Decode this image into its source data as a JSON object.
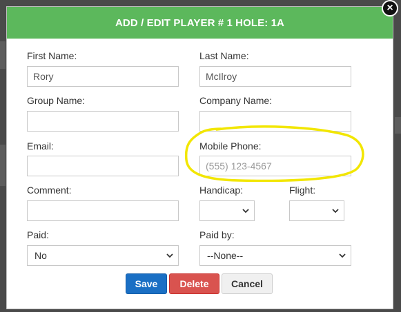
{
  "modal": {
    "title": "ADD / EDIT PLAYER # 1 HOLE: 1A",
    "close_symbol": "×",
    "header_color": "#5cb85c"
  },
  "form": {
    "first_name": {
      "label": "First Name:",
      "value": "Rory",
      "placeholder": ""
    },
    "last_name": {
      "label": "Last Name:",
      "value": "McIlroy",
      "placeholder": ""
    },
    "group_name": {
      "label": "Group Name:",
      "value": "",
      "placeholder": ""
    },
    "company_name": {
      "label": "Company Name:",
      "value": "",
      "placeholder": ""
    },
    "email": {
      "label": "Email:",
      "value": "",
      "placeholder": ""
    },
    "mobile_phone": {
      "label": "Mobile Phone:",
      "value": "",
      "placeholder": "(555) 123-4567"
    },
    "comment": {
      "label": "Comment:",
      "value": "",
      "placeholder": ""
    },
    "handicap": {
      "label": "Handicap:",
      "selected": ""
    },
    "flight": {
      "label": "Flight:",
      "selected": ""
    },
    "paid": {
      "label": "Paid:",
      "selected": "No"
    },
    "paid_by": {
      "label": "Paid by:",
      "selected": "--None--"
    }
  },
  "buttons": {
    "save": "Save",
    "delete": "Delete",
    "cancel": "Cancel"
  },
  "annotation": {
    "highlight_color": "#f2e600",
    "target": "mobile-phone"
  },
  "icons": {
    "close": "close-icon",
    "dropdown": "chevron-down-icon"
  }
}
